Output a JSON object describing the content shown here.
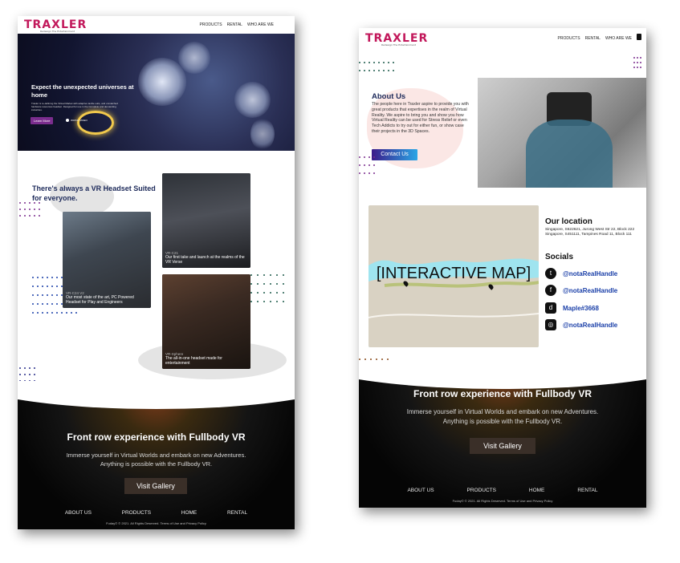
{
  "pageA": {
    "nav": {
      "logo": "TRAXLER",
      "logo_sub": "Redesign The Entertainment",
      "links": [
        "PRODUCTS",
        "RENTAL",
        "WHO ARE WE"
      ]
    },
    "hero": {
      "title": "Expect the unexpected universes at home",
      "desc": "Traxler is re-defining the Virtual Market with adaptive tactile suits, and unmatched hardware resources headset. Designed for use in the Complete and demanding industries.",
      "button": "Learn More",
      "watch": "WATCH VIDEO"
    },
    "products": {
      "heading": "There's always a VR Headset Suited for everyone.",
      "cards": [
        {
          "code": "VR-C24 V2",
          "caption": "Our most state of the art, PC Powered Headset for Play and Engineers"
        },
        {
          "code": "VR-C21",
          "caption": "Our first take and launch at the realms of the VR Verse"
        },
        {
          "code": "VR-Sphere",
          "caption": "The all-in-one headset made for entertainment"
        }
      ]
    },
    "cosmos": {
      "title": "Front row experience with Fullbody VR",
      "sub1": "Immerse yourself in Virtual Worlds and embark on new Adventures.",
      "sub2": "Anything is possible with the Fullbody VR.",
      "button": "Visit Gallery",
      "footer": [
        "ABOUT US",
        "PRODUCTS",
        "HOME",
        "RENTAL"
      ],
      "copyright": "Fuday© © 2021. All Rights Deserved. Terms of Use and Privacy Policy"
    }
  },
  "pageB": {
    "nav": {
      "logo": "TRAXLER",
      "logo_sub": "Redesign The Entertainment",
      "links": [
        "PRODUCTS",
        "RENTAL",
        "WHO ARE WE"
      ]
    },
    "about": {
      "title": "About Us",
      "text": "The people here in Traxler aspire to provide you with great products that expertises in the realm of Virtual Reality. We aspire to bring you and show you how Virtual Reality can be used for Stress Relief or even Tech Addicts to try out for either fun, or show case their projects in the 3D Spaces.",
      "button": "Contact Us"
    },
    "map": {
      "label": "[INTERACTIVE MAP]"
    },
    "location": {
      "title": "Our location",
      "addr1": "Singapore, S622621, Jurong West Str 22, Block 222",
      "addr2": "Singapore, S451111, Tampines Road 11, Block 111"
    },
    "socials": {
      "title": "Socials",
      "items": [
        {
          "icon": "twitter-icon",
          "glyph": "t",
          "handle": "@notaRealHandle"
        },
        {
          "icon": "facebook-icon",
          "glyph": "f",
          "handle": "@notaRealHandle"
        },
        {
          "icon": "discord-icon",
          "glyph": "d",
          "handle": "Maple#3668"
        },
        {
          "icon": "instagram-icon",
          "glyph": "◎",
          "handle": "@notaRealHandle"
        }
      ]
    },
    "cosmos": {
      "title": "Front row experience with Fullbody VR",
      "sub1": "Immerse yourself in Virtual Worlds and embark on new Adventures.",
      "sub2": "Anything is possible with the Fullbody VR.",
      "button": "Visit Gallery",
      "footer": [
        "ABOUT US",
        "PRODUCTS",
        "HOME",
        "RENTAL"
      ],
      "copyright": "Fuday© © 2021. All Rights Deserved. Terms of Use and Privacy Policy"
    }
  },
  "colors": {
    "accent_purple": "#7b2d8e",
    "heading_navy": "#1d2a5a",
    "link_blue": "#1a3fa8",
    "logo_pink": "#c2185b"
  }
}
